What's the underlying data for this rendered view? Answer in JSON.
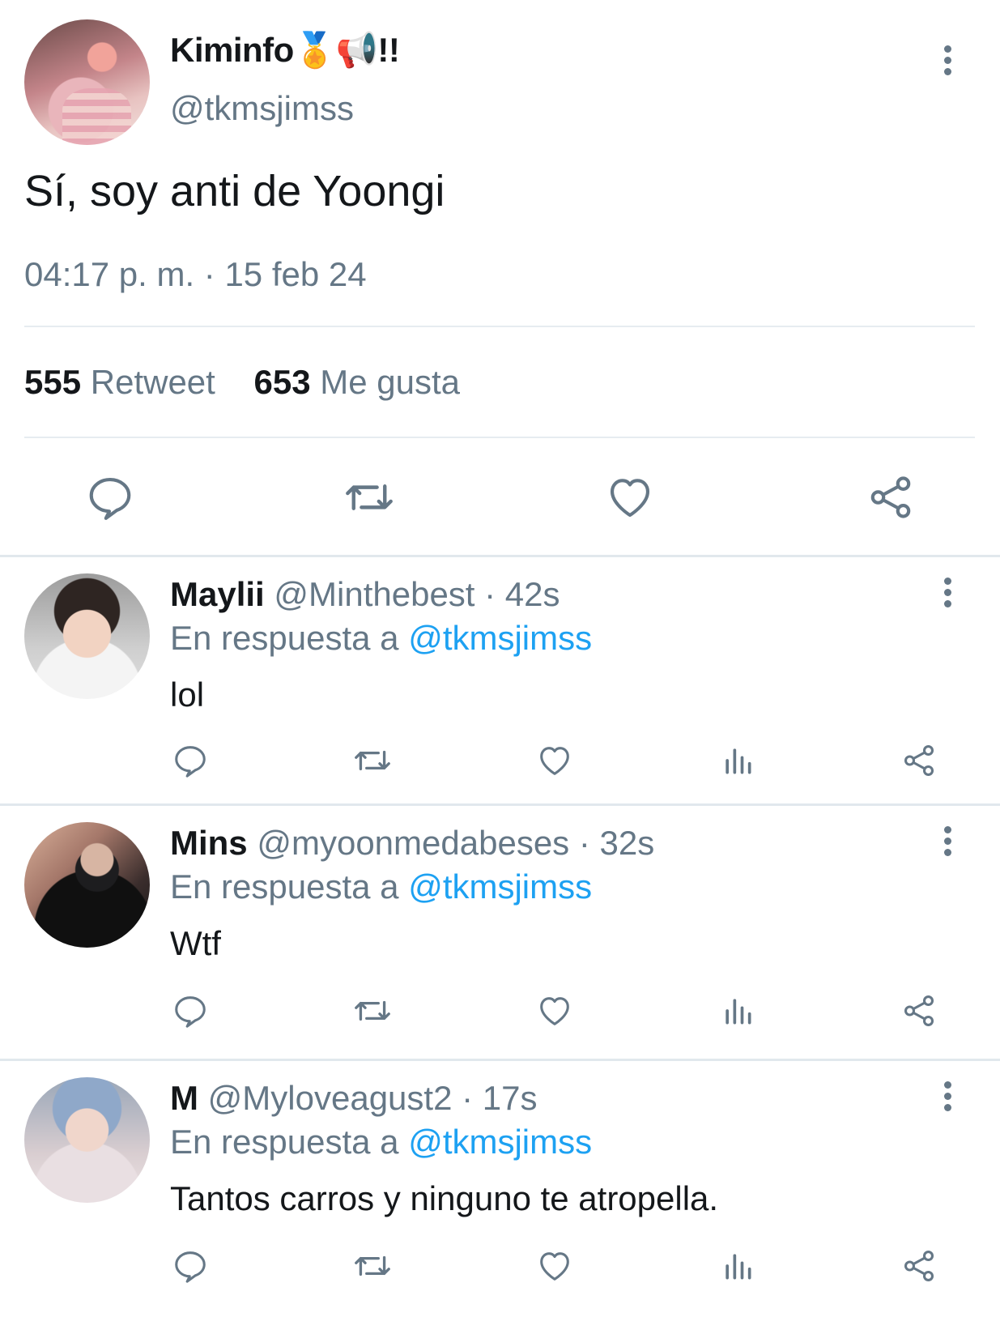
{
  "main_tweet": {
    "name": "Kiminfo🏅📢!!",
    "handle": "@tkmsjimss",
    "text": "Sí, soy anti de Yoongi",
    "timestamp": "04:17 p. m. · 15 feb 24",
    "retweet_count": "555",
    "retweet_label": "Retweet",
    "like_count": "653",
    "like_label": "Me gusta"
  },
  "replies": [
    {
      "name": "Maylii",
      "handle": "@Minthebest",
      "time": "· 42s",
      "in_reply_prefix": "En respuesta a",
      "in_reply_handle": "@tkmsjimss",
      "text": "lol"
    },
    {
      "name": "Mins",
      "handle": "@myoonmedabeses",
      "time": "· 32s",
      "in_reply_prefix": "En respuesta a",
      "in_reply_handle": "@tkmsjimss",
      "text": "Wtf"
    },
    {
      "name": "M",
      "handle": "@Myloveagust2",
      "time": "· 17s",
      "in_reply_prefix": "En respuesta a",
      "in_reply_handle": "@tkmsjimss",
      "text": "Tantos carros y ninguno te atropella."
    }
  ],
  "icons": {
    "reply": "reply-icon",
    "retweet": "retweet-icon",
    "like": "heart-icon",
    "stats": "analytics-icon",
    "share": "share-icon",
    "more": "more-icon"
  },
  "colors": {
    "text": "#14171a",
    "secondary": "#657786",
    "link": "#1da1f2",
    "divider": "#e6ecf0"
  }
}
